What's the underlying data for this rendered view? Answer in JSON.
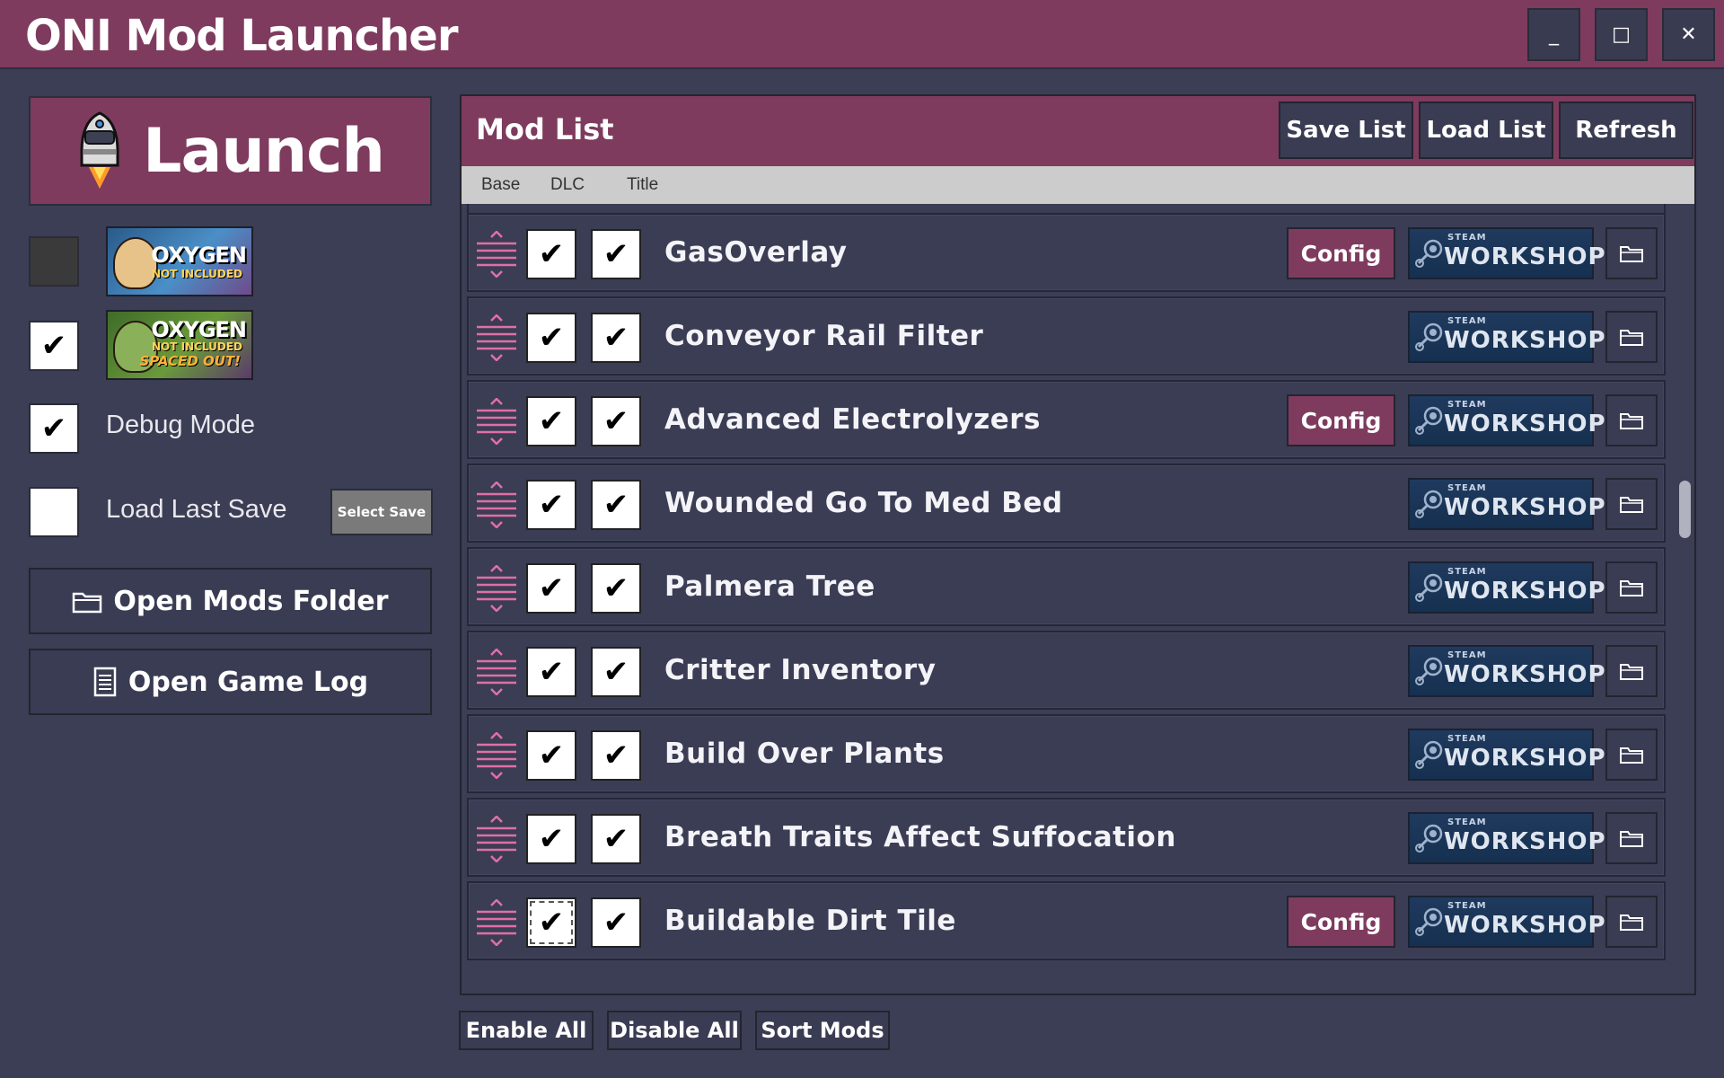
{
  "window": {
    "title": "ONI Mod Launcher",
    "minimize": "_",
    "maximize": "□",
    "close": "✕"
  },
  "sidebar": {
    "launch_label": "Launch",
    "base_game_checked": false,
    "dlc_checked": true,
    "banner_base": {
      "title": "OXYGEN",
      "subtitle": "NOT INCLUDED"
    },
    "banner_dlc": {
      "title": "OXYGEN",
      "subtitle": "NOT INCLUDED",
      "tag": "SPACED OUT!"
    },
    "debug_mode_label": "Debug Mode",
    "debug_mode_checked": true,
    "load_last_save_label": "Load Last Save",
    "load_last_save_checked": false,
    "select_save_label": "Select Save",
    "open_mods_folder_label": "Open Mods Folder",
    "open_game_log_label": "Open Game Log"
  },
  "mod_list": {
    "title": "Mod List",
    "save_list_label": "Save List",
    "load_list_label": "Load List",
    "refresh_label": "Refresh",
    "columns": {
      "base": "Base",
      "dlc": "DLC",
      "title": "Title"
    },
    "config_label": "Config",
    "workshop_steam": "STEAM",
    "workshop_label": "WORKSHOP",
    "mods": [
      {
        "name": "GasOverlay",
        "base": true,
        "dlc": true,
        "has_config": true
      },
      {
        "name": "Conveyor Rail Filter",
        "base": true,
        "dlc": true,
        "has_config": false
      },
      {
        "name": "Advanced Electrolyzers",
        "base": true,
        "dlc": true,
        "has_config": true
      },
      {
        "name": "Wounded Go To Med Bed",
        "base": true,
        "dlc": true,
        "has_config": false
      },
      {
        "name": "Palmera Tree",
        "base": true,
        "dlc": true,
        "has_config": false
      },
      {
        "name": "Critter Inventory",
        "base": true,
        "dlc": true,
        "has_config": false
      },
      {
        "name": "Build Over Plants",
        "base": true,
        "dlc": true,
        "has_config": false
      },
      {
        "name": "Breath Traits Affect Suffocation",
        "base": true,
        "dlc": true,
        "has_config": false
      },
      {
        "name": "Buildable Dirt Tile",
        "base": true,
        "dlc": true,
        "has_config": true
      }
    ]
  },
  "bottom_bar": {
    "enable_all_label": "Enable All",
    "disable_all_label": "Disable All",
    "sort_mods_label": "Sort Mods"
  },
  "colors": {
    "accent": "#7e3b5e",
    "background": "#3b3e54",
    "button": "#393c52",
    "handle": "#e06fa6"
  },
  "icons": {
    "launch": "rocket-icon",
    "folder": "folder-icon",
    "log": "document-icon",
    "drag": "drag-handle-icon",
    "check": "check-icon",
    "steam": "steam-logo-icon"
  }
}
